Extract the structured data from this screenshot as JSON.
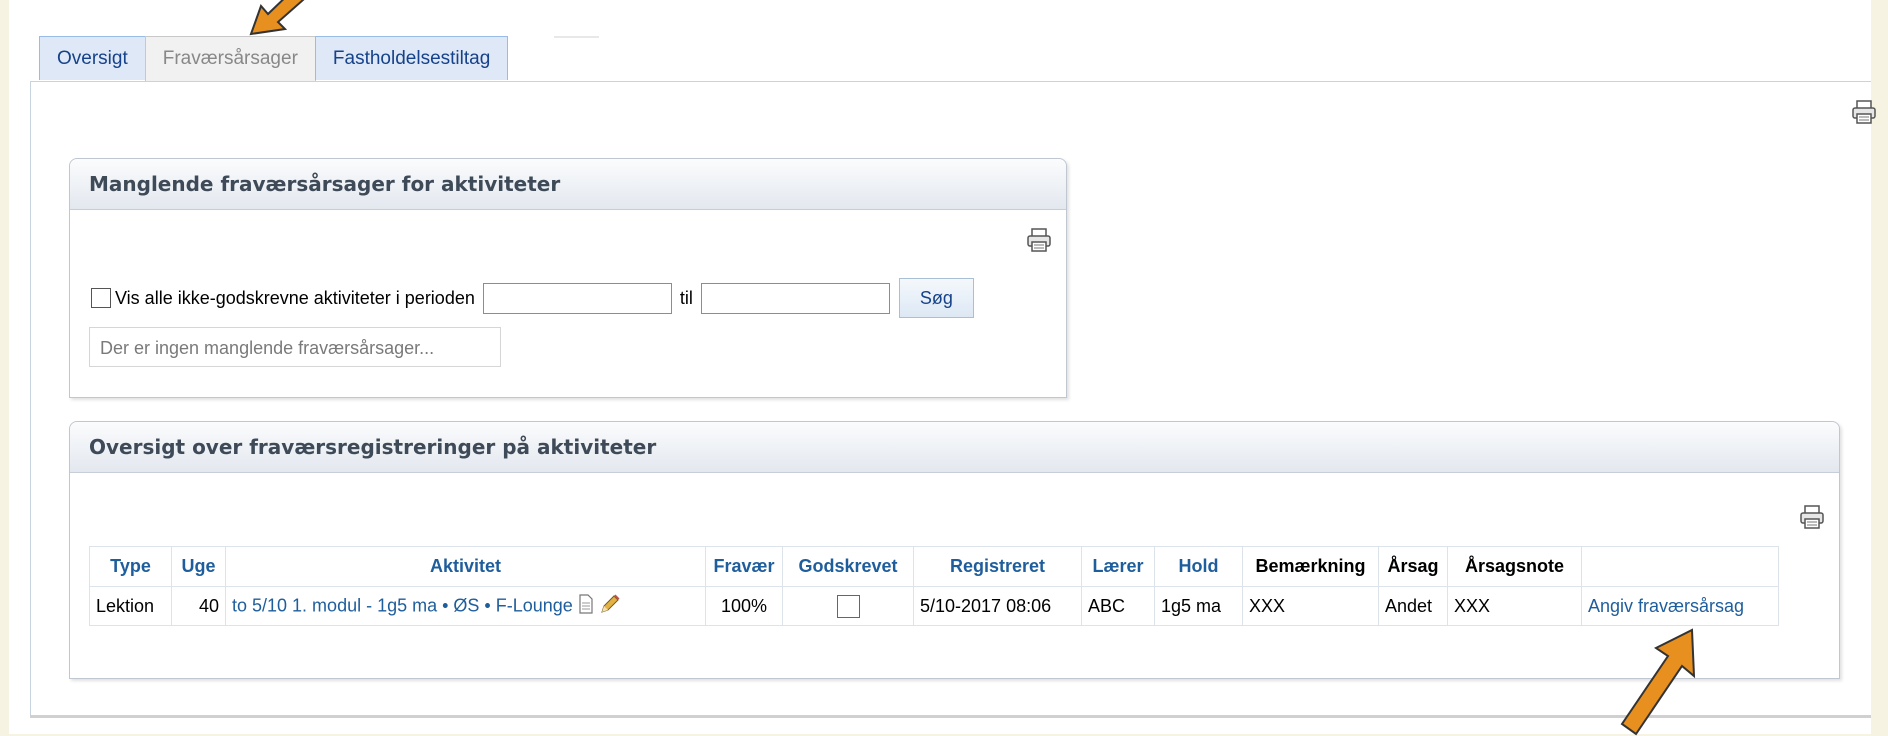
{
  "tabs": [
    {
      "label": "Oversigt",
      "active": false
    },
    {
      "label": "Fraværsårsager",
      "active": true
    },
    {
      "label": "Fastholdelsestiltag",
      "active": false
    }
  ],
  "panel_missing": {
    "title": "Manglende fraværsårsager for aktiviteter",
    "show_all_label": "Vis alle ikke-godskrevne aktiviteter i perioden",
    "from_value": "",
    "to_label": "til",
    "to_value": "",
    "search_label": "Søg",
    "empty_note": "Der er ingen manglende fraværsårsager..."
  },
  "panel_overview": {
    "title": "Oversigt over fraværsregistreringer på aktiviteter",
    "columns": [
      "Type",
      "Uge",
      "Aktivitet",
      "Fravær",
      "Godskrevet",
      "Registreret",
      "Lærer",
      "Hold",
      "Bemærkning",
      "Årsag",
      "Årsagsnote",
      ""
    ],
    "rows": [
      {
        "type": "Lektion",
        "uge": "40",
        "aktivitet": "to 5/10 1. modul - 1g5 ma • ØS • F-Lounge",
        "fravaer": "100%",
        "godskrevet": false,
        "registreret": "5/10-2017 08:06",
        "laerer": "ABC",
        "hold": "1g5 ma",
        "bemaerkning": "XXX",
        "aarsag": "Andet",
        "aarsagsnote": "XXX",
        "action": "Angiv fraværsårsag"
      }
    ]
  },
  "icons": [
    "printer-icon",
    "document-icon",
    "pencil-icon"
  ],
  "colors": {
    "tab_bg": "#dfe8f6",
    "link": "#1f5e9c",
    "arrow": "#e8901f",
    "background": "#f6f3e3"
  }
}
